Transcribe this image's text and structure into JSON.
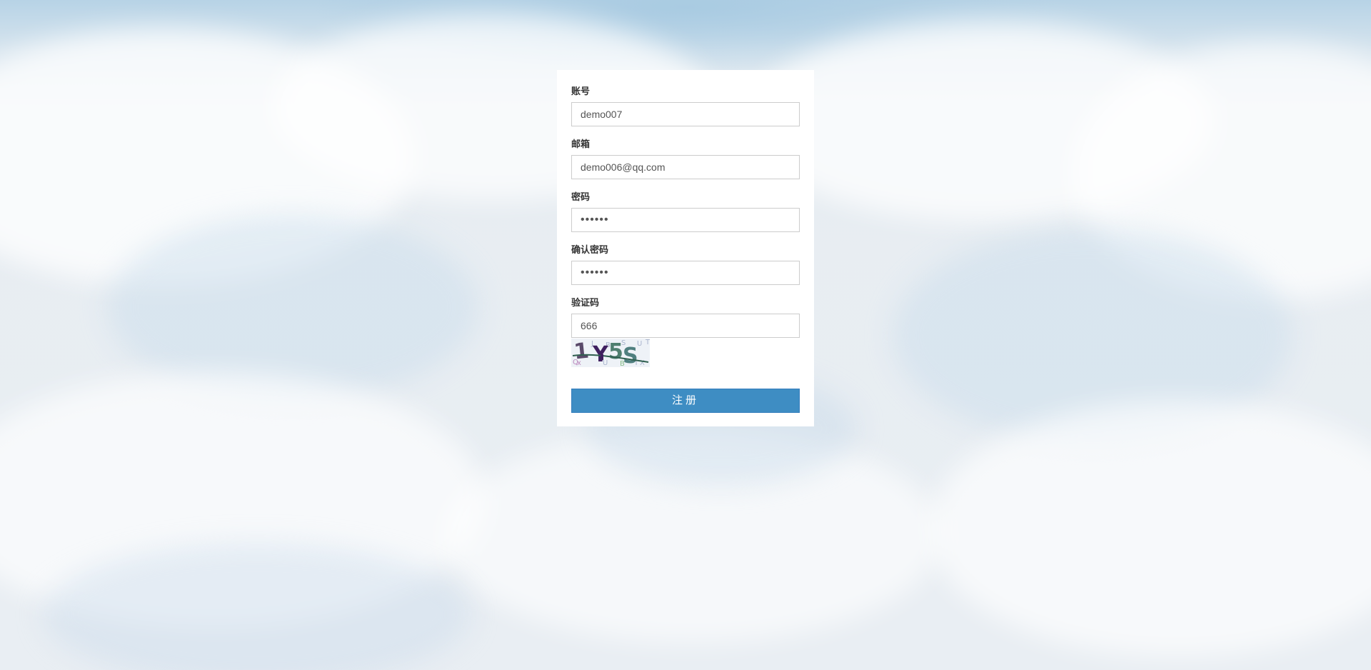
{
  "form": {
    "account_label": "账号",
    "account_value": "demo007",
    "email_label": "邮箱",
    "email_value": "demo006@qq.com",
    "password_label": "密码",
    "password_value": "666666",
    "confirm_label": "确认密码",
    "confirm_value": "666666",
    "captcha_label": "验证码",
    "captcha_value": "666",
    "captcha_image_text": "1Y5S",
    "submit_label": "注册"
  },
  "colors": {
    "button": "#3e8dc3",
    "card": "#ffffff",
    "sky": "#b7d3e6"
  }
}
